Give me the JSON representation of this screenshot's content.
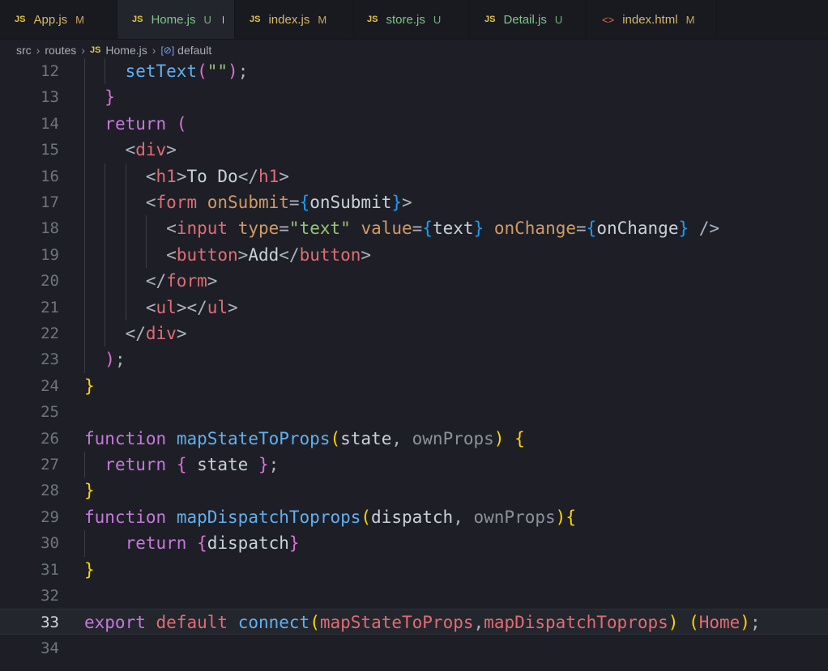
{
  "tabs": [
    {
      "name": "App.js",
      "badge": "M",
      "status": "modified",
      "type": "js"
    },
    {
      "name": "Home.js",
      "badge": "U",
      "status": "untracked",
      "type": "js",
      "active": true,
      "unsaved": true
    },
    {
      "name": "index.js",
      "badge": "M",
      "status": "modified",
      "type": "js"
    },
    {
      "name": "store.js",
      "badge": "U",
      "status": "untracked",
      "type": "js"
    },
    {
      "name": "Detail.js",
      "badge": "U",
      "status": "untracked",
      "type": "js"
    },
    {
      "name": "index.html",
      "badge": "M",
      "status": "modified",
      "type": "html"
    }
  ],
  "breadcrumb": {
    "parts": [
      "src",
      "routes",
      "Home.js",
      "default"
    ],
    "file_icon": "JS",
    "symbol_icon": "symbol-icon"
  },
  "editor": {
    "current_line": 33,
    "lines": [
      {
        "n": 12,
        "ind": 2,
        "t": [
          [
            "setText",
            "fn"
          ],
          [
            "(",
            "b2"
          ],
          [
            "\"\"",
            "str"
          ],
          [
            ")",
            "b2"
          ],
          [
            ";",
            "pu"
          ]
        ]
      },
      {
        "n": 13,
        "ind": 1,
        "t": [
          [
            "}",
            "b2"
          ]
        ]
      },
      {
        "n": 14,
        "ind": 1,
        "t": [
          [
            "return",
            "kw"
          ],
          [
            " ",
            "pl"
          ],
          [
            "(",
            "b2"
          ]
        ]
      },
      {
        "n": 15,
        "ind": 2,
        "t": [
          [
            "<",
            "pu"
          ],
          [
            "div",
            "tag"
          ],
          [
            ">",
            "pu"
          ]
        ]
      },
      {
        "n": 16,
        "ind": 3,
        "t": [
          [
            "<",
            "pu"
          ],
          [
            "h1",
            "tag"
          ],
          [
            ">",
            "pu"
          ],
          [
            "To Do",
            "pl"
          ],
          [
            "</",
            "pu"
          ],
          [
            "h1",
            "tag"
          ],
          [
            ">",
            "pu"
          ]
        ]
      },
      {
        "n": 17,
        "ind": 3,
        "t": [
          [
            "<",
            "pu"
          ],
          [
            "form",
            "tag"
          ],
          [
            " ",
            "pl"
          ],
          [
            "onSubmit",
            "attr"
          ],
          [
            "=",
            "pu"
          ],
          [
            "{",
            "b3"
          ],
          [
            "onSubmit",
            "pl"
          ],
          [
            "}",
            "b3"
          ],
          [
            ">",
            "pu"
          ]
        ]
      },
      {
        "n": 18,
        "ind": 4,
        "t": [
          [
            "<",
            "pu"
          ],
          [
            "input",
            "tag"
          ],
          [
            " ",
            "pl"
          ],
          [
            "type",
            "attr"
          ],
          [
            "=",
            "pu"
          ],
          [
            "\"text\"",
            "str"
          ],
          [
            " ",
            "pl"
          ],
          [
            "value",
            "attr"
          ],
          [
            "=",
            "pu"
          ],
          [
            "{",
            "b3"
          ],
          [
            "text",
            "pl"
          ],
          [
            "}",
            "b3"
          ],
          [
            " ",
            "pl"
          ],
          [
            "onChange",
            "attr"
          ],
          [
            "=",
            "pu"
          ],
          [
            "{",
            "b3"
          ],
          [
            "onChange",
            "pl"
          ],
          [
            "}",
            "b3"
          ],
          [
            " />",
            "pu"
          ]
        ]
      },
      {
        "n": 19,
        "ind": 4,
        "t": [
          [
            "<",
            "pu"
          ],
          [
            "button",
            "tag"
          ],
          [
            ">",
            "pu"
          ],
          [
            "Add",
            "pl"
          ],
          [
            "</",
            "pu"
          ],
          [
            "button",
            "tag"
          ],
          [
            ">",
            "pu"
          ]
        ]
      },
      {
        "n": 20,
        "ind": 3,
        "t": [
          [
            "</",
            "pu"
          ],
          [
            "form",
            "tag"
          ],
          [
            ">",
            "pu"
          ]
        ]
      },
      {
        "n": 21,
        "ind": 3,
        "t": [
          [
            "<",
            "pu"
          ],
          [
            "ul",
            "tag"
          ],
          [
            "></",
            "pu"
          ],
          [
            "ul",
            "tag"
          ],
          [
            ">",
            "pu"
          ]
        ]
      },
      {
        "n": 22,
        "ind": 2,
        "t": [
          [
            "</",
            "pu"
          ],
          [
            "div",
            "tag"
          ],
          [
            ">",
            "pu"
          ]
        ]
      },
      {
        "n": 23,
        "ind": 1,
        "t": [
          [
            ")",
            "b2"
          ],
          [
            ";",
            "pu"
          ]
        ]
      },
      {
        "n": 24,
        "ind": 0,
        "t": [
          [
            "}",
            "b1"
          ]
        ]
      },
      {
        "n": 25,
        "ind": 0,
        "t": []
      },
      {
        "n": 26,
        "ind": 0,
        "t": [
          [
            "function",
            "kw"
          ],
          [
            " ",
            "pl"
          ],
          [
            "mapStateToProps",
            "fn"
          ],
          [
            "(",
            "b1"
          ],
          [
            "state",
            "pl"
          ],
          [
            ", ",
            "pu"
          ],
          [
            "ownProps",
            "dim"
          ],
          [
            ")",
            "b1"
          ],
          [
            " ",
            "pl"
          ],
          [
            "{",
            "b1"
          ]
        ]
      },
      {
        "n": 27,
        "ind": 1,
        "t": [
          [
            "return",
            "kw"
          ],
          [
            " ",
            "pl"
          ],
          [
            "{",
            "b2"
          ],
          [
            " state ",
            "pl"
          ],
          [
            "}",
            "b2"
          ],
          [
            ";",
            "pu"
          ]
        ]
      },
      {
        "n": 28,
        "ind": 0,
        "t": [
          [
            "}",
            "b1"
          ]
        ]
      },
      {
        "n": 29,
        "ind": 0,
        "t": [
          [
            "function",
            "kw"
          ],
          [
            " ",
            "pl"
          ],
          [
            "mapDispatchToprops",
            "fn"
          ],
          [
            "(",
            "b1"
          ],
          [
            "dispatch",
            "pl"
          ],
          [
            ", ",
            "pu"
          ],
          [
            "ownProps",
            "dim"
          ],
          [
            ")",
            "b1"
          ],
          [
            "{",
            "b1"
          ]
        ]
      },
      {
        "n": 30,
        "ind": 2,
        "t": [
          [
            "return",
            "kw"
          ],
          [
            " ",
            "pl"
          ],
          [
            "{",
            "b2"
          ],
          [
            "dispatch",
            "pl"
          ],
          [
            "}",
            "b2"
          ]
        ]
      },
      {
        "n": 31,
        "ind": 0,
        "t": [
          [
            "}",
            "b1"
          ]
        ]
      },
      {
        "n": 32,
        "ind": 0,
        "t": []
      },
      {
        "n": 33,
        "ind": 0,
        "t": [
          [
            "export",
            "kw"
          ],
          [
            " ",
            "pl"
          ],
          [
            "default",
            "tag"
          ],
          [
            " ",
            "pl"
          ],
          [
            "connect",
            "fn"
          ],
          [
            "(",
            "b1"
          ],
          [
            "mapStateToProps",
            "tag"
          ],
          [
            ",",
            "pu"
          ],
          [
            "mapDispatchToprops",
            "tag"
          ],
          [
            ")",
            "b1"
          ],
          [
            " ",
            "pl"
          ],
          [
            "(",
            "b1"
          ],
          [
            "Home",
            "tag"
          ],
          [
            ")",
            "b1"
          ],
          [
            ";",
            "pu"
          ]
        ]
      },
      {
        "n": 34,
        "ind": 0,
        "t": []
      }
    ]
  }
}
